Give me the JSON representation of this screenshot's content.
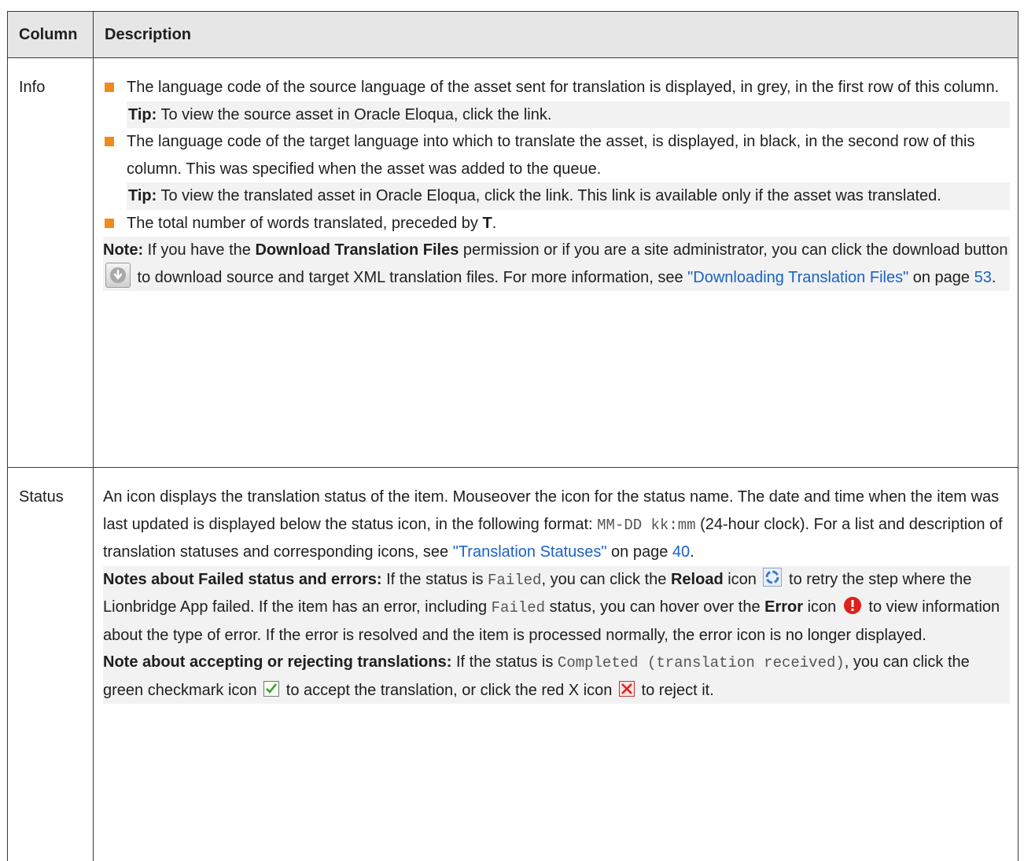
{
  "header": {
    "column_label": "Column",
    "description_label": "Description"
  },
  "info_row": {
    "name": "Info",
    "bullet1": "The language code of the source language of the asset sent for translation is displayed, in grey, in the first row of this column.",
    "tip1_label": "Tip:",
    "tip1_text": " To view the source asset in Oracle Eloqua, click the link.",
    "bullet2": "The language code of the target language into which to translate the asset, is displayed, in black, in the second row of this column. This was specified when the asset was added to the queue.",
    "tip2_label": "Tip:",
    "tip2_text": " To view the translated asset in Oracle Eloqua, click the link. This link is available only if the asset was translated.",
    "bullet3_text": "The total number of words translated, preceded by ",
    "bullet3_bold": "T",
    "bullet3_end": ".",
    "note_label": "Note:",
    "note_text1": " If you have the ",
    "note_bold1": "Download Translation Files",
    "note_text2": " permission or if you are a site administrator, you can click the download button ",
    "note_text3": " to download source and target XML translation files. For more information, see ",
    "note_link": "\"Downloading Translation Files\"",
    "note_text4": " on page ",
    "note_page": "53",
    "note_end": "."
  },
  "status_row": {
    "name": "Status",
    "p1_text1": "An icon displays the translation status of the item. Mouseover the icon for the status name. The date and time when the item was last updated is displayed below the status icon, in the following format: ",
    "p1_mono": "MM-DD kk:mm",
    "p1_text2": " (24-hour clock). For a list and description of translation statuses and corresponding icons, see ",
    "p1_link": "\"Translation Statuses\"",
    "p1_text3": " on page ",
    "p1_page": "40",
    "p1_end": ".",
    "n1_label": "Notes about Failed status and errors:",
    "n1_text1": " If the status is ",
    "n1_mono1": "Failed",
    "n1_text2": ", you can click the ",
    "n1_bold1": "Reload",
    "n1_text3": " icon ",
    "n1_text4": " to retry the step where the Lionbridge App failed. If the item has an error, including ",
    "n1_mono2": "Failed",
    "n1_text5": " status, you can hover over the ",
    "n1_bold2": "Error",
    "n1_text6": " icon ",
    "n1_text7": " to view information about the type of error. If the error is resolved and the item is processed normally, the error icon is no longer displayed.",
    "n2_label": "Note about accepting or rejecting translations:",
    "n2_text1": " If the status is ",
    "n2_mono": "Completed (translation received)",
    "n2_text2": ", you can click the green checkmark icon ",
    "n2_text3": " to accept the translation, or click the red X icon ",
    "n2_text4": " to reject it."
  },
  "colors": {
    "bullet": "#f08a1d",
    "link": "#1a62c7",
    "header_bg": "#e6e6e6",
    "tip_bg": "#f2f2f2"
  },
  "icons": [
    "download-button-icon",
    "reload-icon",
    "error-icon",
    "green-checkmark-icon",
    "red-x-icon"
  ]
}
